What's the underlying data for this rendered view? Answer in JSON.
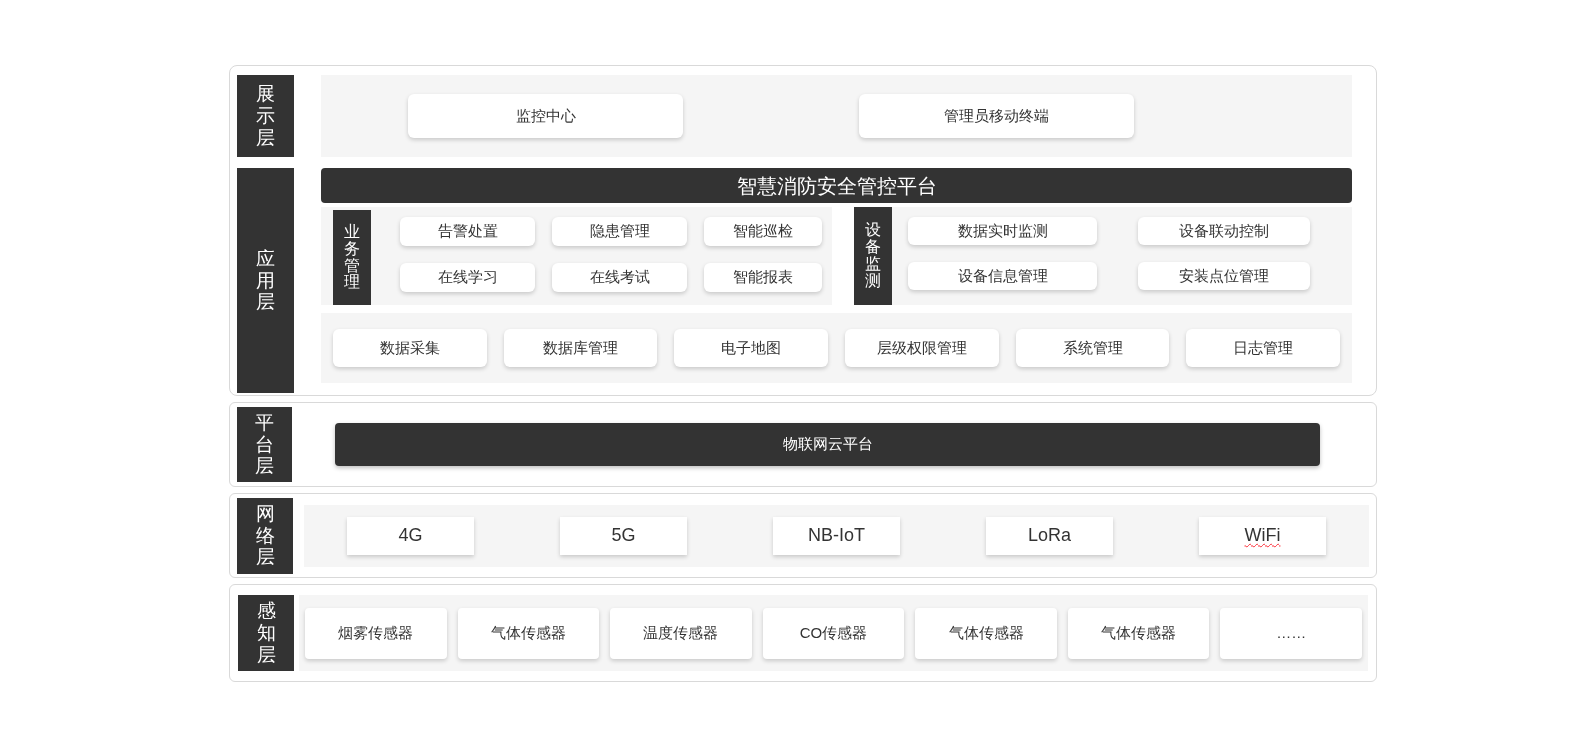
{
  "top_section": {
    "display_layer": {
      "label": "展示层",
      "items": [
        "监控中心",
        "管理员移动终端"
      ]
    },
    "application_layer": {
      "label": "应用层",
      "title": "智慧消防安全管控平台",
      "business": {
        "label": "业务管理",
        "items": [
          "告警处置",
          "隐患管理",
          "智能巡检",
          "在线学习",
          "在线考试",
          "智能报表"
        ]
      },
      "device_monitoring": {
        "label": "设备监测",
        "items": [
          "数据实时监测",
          "设备联动控制",
          "设备信息管理",
          "安装点位管理"
        ]
      },
      "common_items": [
        "数据采集",
        "数据库管理",
        "电子地图",
        "层级权限管理",
        "系统管理",
        "日志管理"
      ]
    }
  },
  "platform_layer": {
    "label": "平台层",
    "title": "物联网云平台"
  },
  "network_layer": {
    "label": "网络层",
    "items": [
      {
        "text": "4G",
        "spell_error": false
      },
      {
        "text": "5G",
        "spell_error": false
      },
      {
        "text": "NB-IoT",
        "spell_error": false
      },
      {
        "text": "LoRa",
        "spell_error": false
      },
      {
        "text": "WiFi",
        "spell_error": true
      }
    ]
  },
  "perception_layer": {
    "label": "感知层",
    "items": [
      "烟雾传感器",
      "气体传感器",
      "温度传感器",
      "CO传感器",
      "气体传感器",
      "气体传感器",
      "……"
    ]
  }
}
